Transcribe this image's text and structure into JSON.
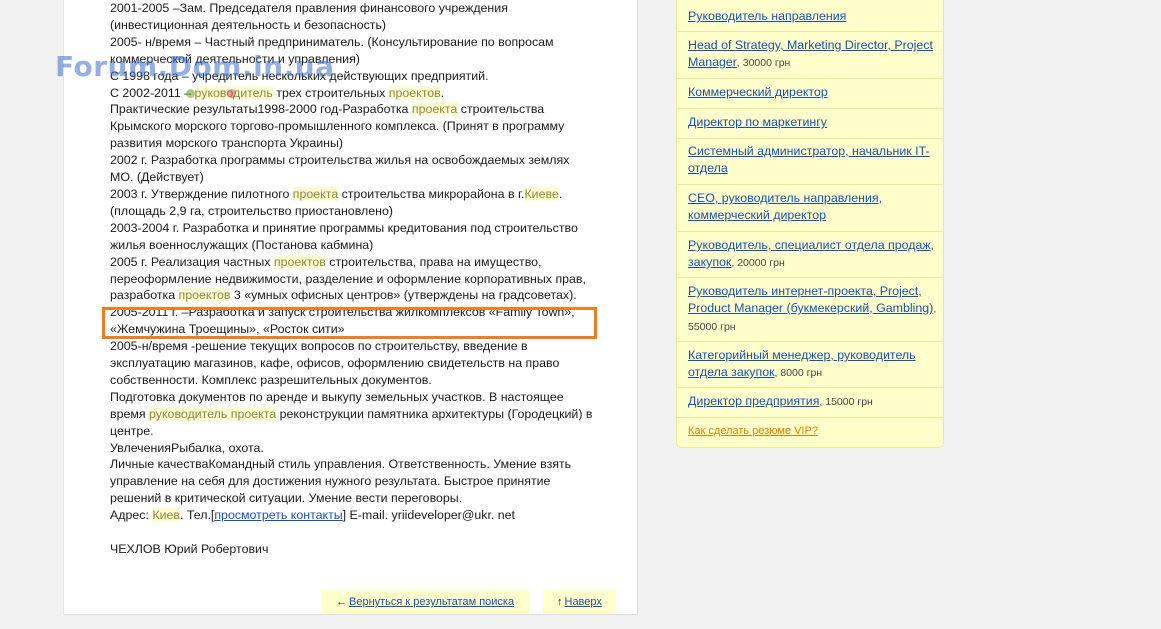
{
  "watermark": "Forum.Dom.in.ua",
  "resume": {
    "lines": [
      "2001-2005 –Зам. Председателя правления финансового учреждения",
      "(инвестиционная деятельность и безопасность)",
      "2005- н/время – Частный предприниматель. (Консультирование по вопросам",
      "коммерческой деятельности и управления)",
      "С 1998 года – учредитель нескольких действующих предприятий."
    ],
    "l6": {
      "a": "С 2002-2011 – ",
      "b": "руководитель",
      "c": " трех строительных ",
      "d": "проектов",
      "e": "."
    },
    "l7": {
      "a": "Практические результаты1998-2000 год-Разработка ",
      "b": "проекта",
      "c": " строительства"
    },
    "lines2": [
      "Крымского морского торгово-промышленного комплекса. (Принят в программу",
      "развития морского транспорта Украины)",
      "2002 г. Разработка программы строительства жилья на освобождаемых землях",
      "МО. (Действует)"
    ],
    "l12": {
      "a": "2003 г. Утверждение пилотного ",
      "b": "проекта",
      "c": " строительства микрорайона в г.",
      "d": "Киеве",
      "e": "."
    },
    "lines3": [
      "(площадь 2,9 га, строительство приостановлено)",
      "2003-2004 г. Разработка и принятие программы кредитования под строительство",
      "жилья военнослужащих (Постанова кабмина)"
    ],
    "l16": {
      "a": "2005 г. Реализация частных ",
      "b": "проектов",
      "c": " строительства, права на имущество,"
    },
    "l17": "переоформление недвижимости, разделение и оформление корпоративных прав,",
    "l18": {
      "a": "разработка ",
      "b": "проектов",
      "c": " 3 «умных офисных центров» (утверждены на градсоветах)."
    },
    "lines4": [
      "2005-2011 г. –Разработка и запуск строительства жилкомплексов «Family Town»,",
      "«Жемчужина Троещины», «Росток сити»",
      "2005-н/время -решение текущих вопросов по строительству, введение в",
      "эксплуатацию магазинов, кафе, офисов, оформлению свидетельств на право",
      "собственности. Комплекс разрешительных документов.",
      "Подготовка документов по аренде и выкупу земельных участков. В настоящее"
    ],
    "l25": {
      "a": "время ",
      "b": "руководитель проекта",
      "c": " реконструкции памятника архитектуры (Городецкий) в"
    },
    "lines5": [
      "центре.",
      "УвлеченияРыбалка, охота.",
      "Личные качестваКомандный стиль управления. Ответственность. Умение взять",
      "управление на себя для достижения нужного результата. Быстрое принятие",
      "решений в критической ситуации. Умение вести переговоры."
    ],
    "l31": {
      "a": "Адрес: ",
      "b": "Киев",
      "c": ". Тел.[",
      "d": "просмотреть контакты",
      "e": "] E-mail. yriideveloper@ukr. net"
    },
    "signature": "ЧЕХЛОВ Юрий Робертович"
  },
  "nav": {
    "back_arrow": "←",
    "back_label": "Вернуться к результатам поиска",
    "up_arrow": "↑",
    "up_label": "Наверх"
  },
  "sidebar": {
    "items": [
      {
        "link": "Руководитель направления",
        "salary": ""
      },
      {
        "link": "Head of Strategy, Marketing Director, Project Manager",
        "salary": "30000 грн"
      },
      {
        "link": "Коммерческий директор",
        "salary": ""
      },
      {
        "link": "Директор по маркетингу",
        "salary": ""
      },
      {
        "link": "Системный администратор, начальник IT-отдела",
        "salary": ""
      },
      {
        "link": "CEO, руководитель направления, коммерческий директор",
        "salary": ""
      },
      {
        "link": "Руководитель, специалист отдела продаж, закупок",
        "salary": "20000 грн"
      },
      {
        "link": "Руководитель интернет-проекта, Project, Product Manager (букмекерский, Gambling)",
        "salary": "55000 грн"
      },
      {
        "link": "Категорийный менеджер, руководитель отдела закупок",
        "salary": "8000 грн"
      },
      {
        "link": "Директор предприятия",
        "salary": "15000 грн"
      }
    ],
    "vip_link": "Как сделать резюме VIP?"
  },
  "colors": {
    "accent_box": "#f07d22",
    "sidebar_bg": "#ffffcc",
    "link": "#1a4fb0",
    "keyword_highlight": "#fbfbd6"
  }
}
